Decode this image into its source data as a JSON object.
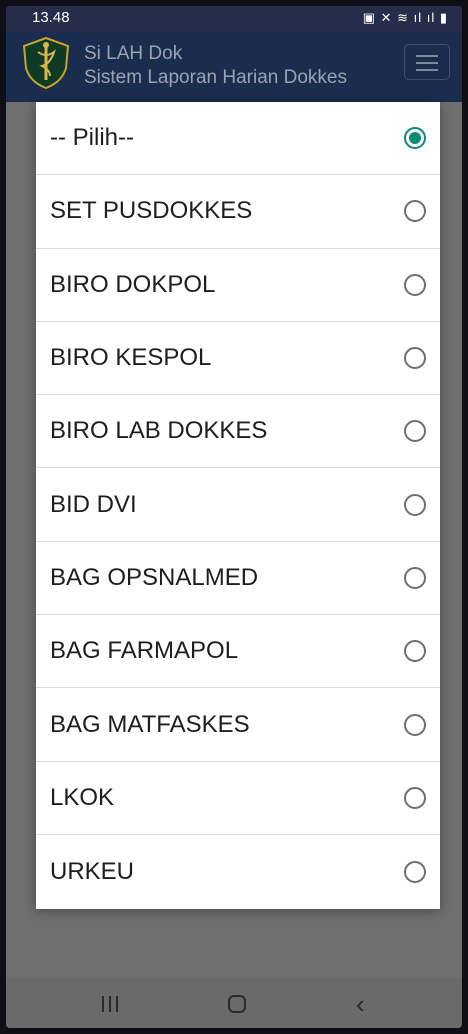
{
  "status_bar": {
    "time": "13.48",
    "icons_text": "▣ ✕ ≋ ıl ıl ▮",
    "icons": [
      "alarm-icon",
      "mute-icon",
      "wifi-icon",
      "volte-icon",
      "signal-icon",
      "signal-icon",
      "battery-icon"
    ]
  },
  "app_bar": {
    "title_line1": "Si LAH Dok",
    "title_line2": "Sistem Laporan Harian Dokkes",
    "logo_icon": "shield-emblem-icon",
    "menu_icon": "hamburger-menu-icon"
  },
  "dialog": {
    "accent_color": "#0b8a78",
    "options": [
      {
        "label": "-- Pilih--",
        "selected": true
      },
      {
        "label": "SET PUSDOKKES",
        "selected": false
      },
      {
        "label": "BIRO DOKPOL",
        "selected": false
      },
      {
        "label": "BIRO KESPOL",
        "selected": false
      },
      {
        "label": "BIRO LAB DOKKES",
        "selected": false
      },
      {
        "label": "BID DVI",
        "selected": false
      },
      {
        "label": "BAG OPSNALMED",
        "selected": false
      },
      {
        "label": "BAG FARMAPOL",
        "selected": false
      },
      {
        "label": "BAG MATFASKES",
        "selected": false
      },
      {
        "label": "LKOK",
        "selected": false
      },
      {
        "label": "URKEU",
        "selected": false
      }
    ]
  },
  "nav_bar": {
    "icons": [
      "recent-apps-icon",
      "home-icon",
      "back-icon"
    ]
  }
}
